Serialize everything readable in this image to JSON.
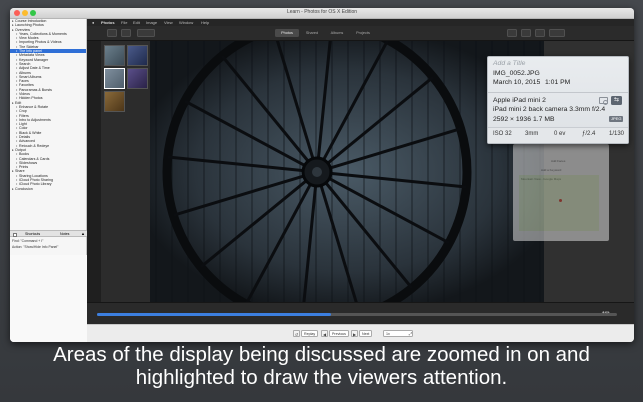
{
  "window": {
    "title": "Learn - Photos for OS X Edition"
  },
  "sidebar": {
    "items": [
      {
        "label": "Course Introduction",
        "level": 1,
        "selected": false
      },
      {
        "label": "Launching Photos",
        "level": 1,
        "selected": false
      },
      {
        "label": "Overview",
        "level": 1,
        "selected": false
      },
      {
        "label": "Years, Collections & Moments",
        "level": 2,
        "selected": false
      },
      {
        "label": "View Modes",
        "level": 2,
        "selected": false
      },
      {
        "label": "Importing Photos & Videos",
        "level": 2,
        "selected": false
      },
      {
        "label": "The Sidebar",
        "level": 2,
        "selected": false
      },
      {
        "label": "The Info panel",
        "level": 2,
        "selected": true
      },
      {
        "label": "Metadata Views",
        "level": 2,
        "selected": false
      },
      {
        "label": "Keyword Manager",
        "level": 2,
        "selected": false
      },
      {
        "label": "Search",
        "level": 2,
        "selected": false
      },
      {
        "label": "Adjust Date & Time",
        "level": 2,
        "selected": false
      },
      {
        "label": "Albums",
        "level": 2,
        "selected": false
      },
      {
        "label": "Smart Albums",
        "level": 2,
        "selected": false
      },
      {
        "label": "Faces",
        "level": 2,
        "selected": false
      },
      {
        "label": "Favorites",
        "level": 2,
        "selected": false
      },
      {
        "label": "Panoramas & Bursts",
        "level": 2,
        "selected": false
      },
      {
        "label": "Videos",
        "level": 2,
        "selected": false
      },
      {
        "label": "Hidden Photos",
        "level": 2,
        "selected": false
      },
      {
        "label": "Edit",
        "level": 1,
        "selected": false
      },
      {
        "label": "Enhance & Rotate",
        "level": 2,
        "selected": false
      },
      {
        "label": "Crop",
        "level": 2,
        "selected": false
      },
      {
        "label": "Filters",
        "level": 2,
        "selected": false
      },
      {
        "label": "Intro to Adjustments",
        "level": 2,
        "selected": false
      },
      {
        "label": "Light",
        "level": 2,
        "selected": false
      },
      {
        "label": "Color",
        "level": 2,
        "selected": false
      },
      {
        "label": "Black & White",
        "level": 2,
        "selected": false
      },
      {
        "label": "Details",
        "level": 2,
        "selected": false
      },
      {
        "label": "Advanced",
        "level": 2,
        "selected": false
      },
      {
        "label": "Retouch & Redeye",
        "level": 2,
        "selected": false
      },
      {
        "label": "Output",
        "level": 1,
        "selected": false
      },
      {
        "label": "Books",
        "level": 2,
        "selected": false
      },
      {
        "label": "Calendars & Cards",
        "level": 2,
        "selected": false
      },
      {
        "label": "Slideshows",
        "level": 2,
        "selected": false
      },
      {
        "label": "Prints",
        "level": 2,
        "selected": false
      },
      {
        "label": "Share",
        "level": 1,
        "selected": false
      },
      {
        "label": "Sharing Locations",
        "level": 2,
        "selected": false
      },
      {
        "label": "iCloud Photo Sharing",
        "level": 2,
        "selected": false
      },
      {
        "label": "iCloud Photo Library",
        "level": 2,
        "selected": false
      },
      {
        "label": "Conclusion",
        "level": 1,
        "selected": false
      }
    ],
    "tabs": {
      "shortcuts": "Shortcuts",
      "notes": "Notes"
    },
    "find_lines": [
      "Find: \"Command + I\"",
      "Action: \"Show/Hide Info Panel\""
    ]
  },
  "photos_app": {
    "menu": [
      "Photos",
      "File",
      "Edit",
      "Image",
      "View",
      "Window",
      "Help"
    ],
    "toolbar_segments": [
      "Photos",
      "Shared",
      "Albums",
      "Projects"
    ],
    "active_segment": "Photos"
  },
  "info_panel": {
    "title_placeholder": "Add a Title",
    "filename": "IMG_0052.JPG",
    "date": "March 10, 2015",
    "time": "1:01 PM",
    "device": "Apple iPad mini 2",
    "lens": "iPad mini 2 back camera 3.3mm f/2.4",
    "dimensions": "2592 × 1936",
    "filesize": "1.7 MB",
    "format_badge": "JPEG",
    "exif": {
      "iso": "ISO 32",
      "focal": "3mm",
      "exposure_bias": "0 ev",
      "aperture": "ƒ/2.4",
      "shutter": "1/130"
    },
    "lower_panel_text": [
      "Add Faces",
      "Add a Keyword",
      "Mountain View - Google Maps"
    ]
  },
  "playback": {
    "buttons": {
      "replay": "Replay",
      "previous": "Previous",
      "next": "Next"
    },
    "speed": "1x",
    "progress": 0.45
  },
  "caption": {
    "line1": "Areas of the display being discussed are zoomed in on and",
    "line2": "highlighted to draw the viewers attention."
  }
}
